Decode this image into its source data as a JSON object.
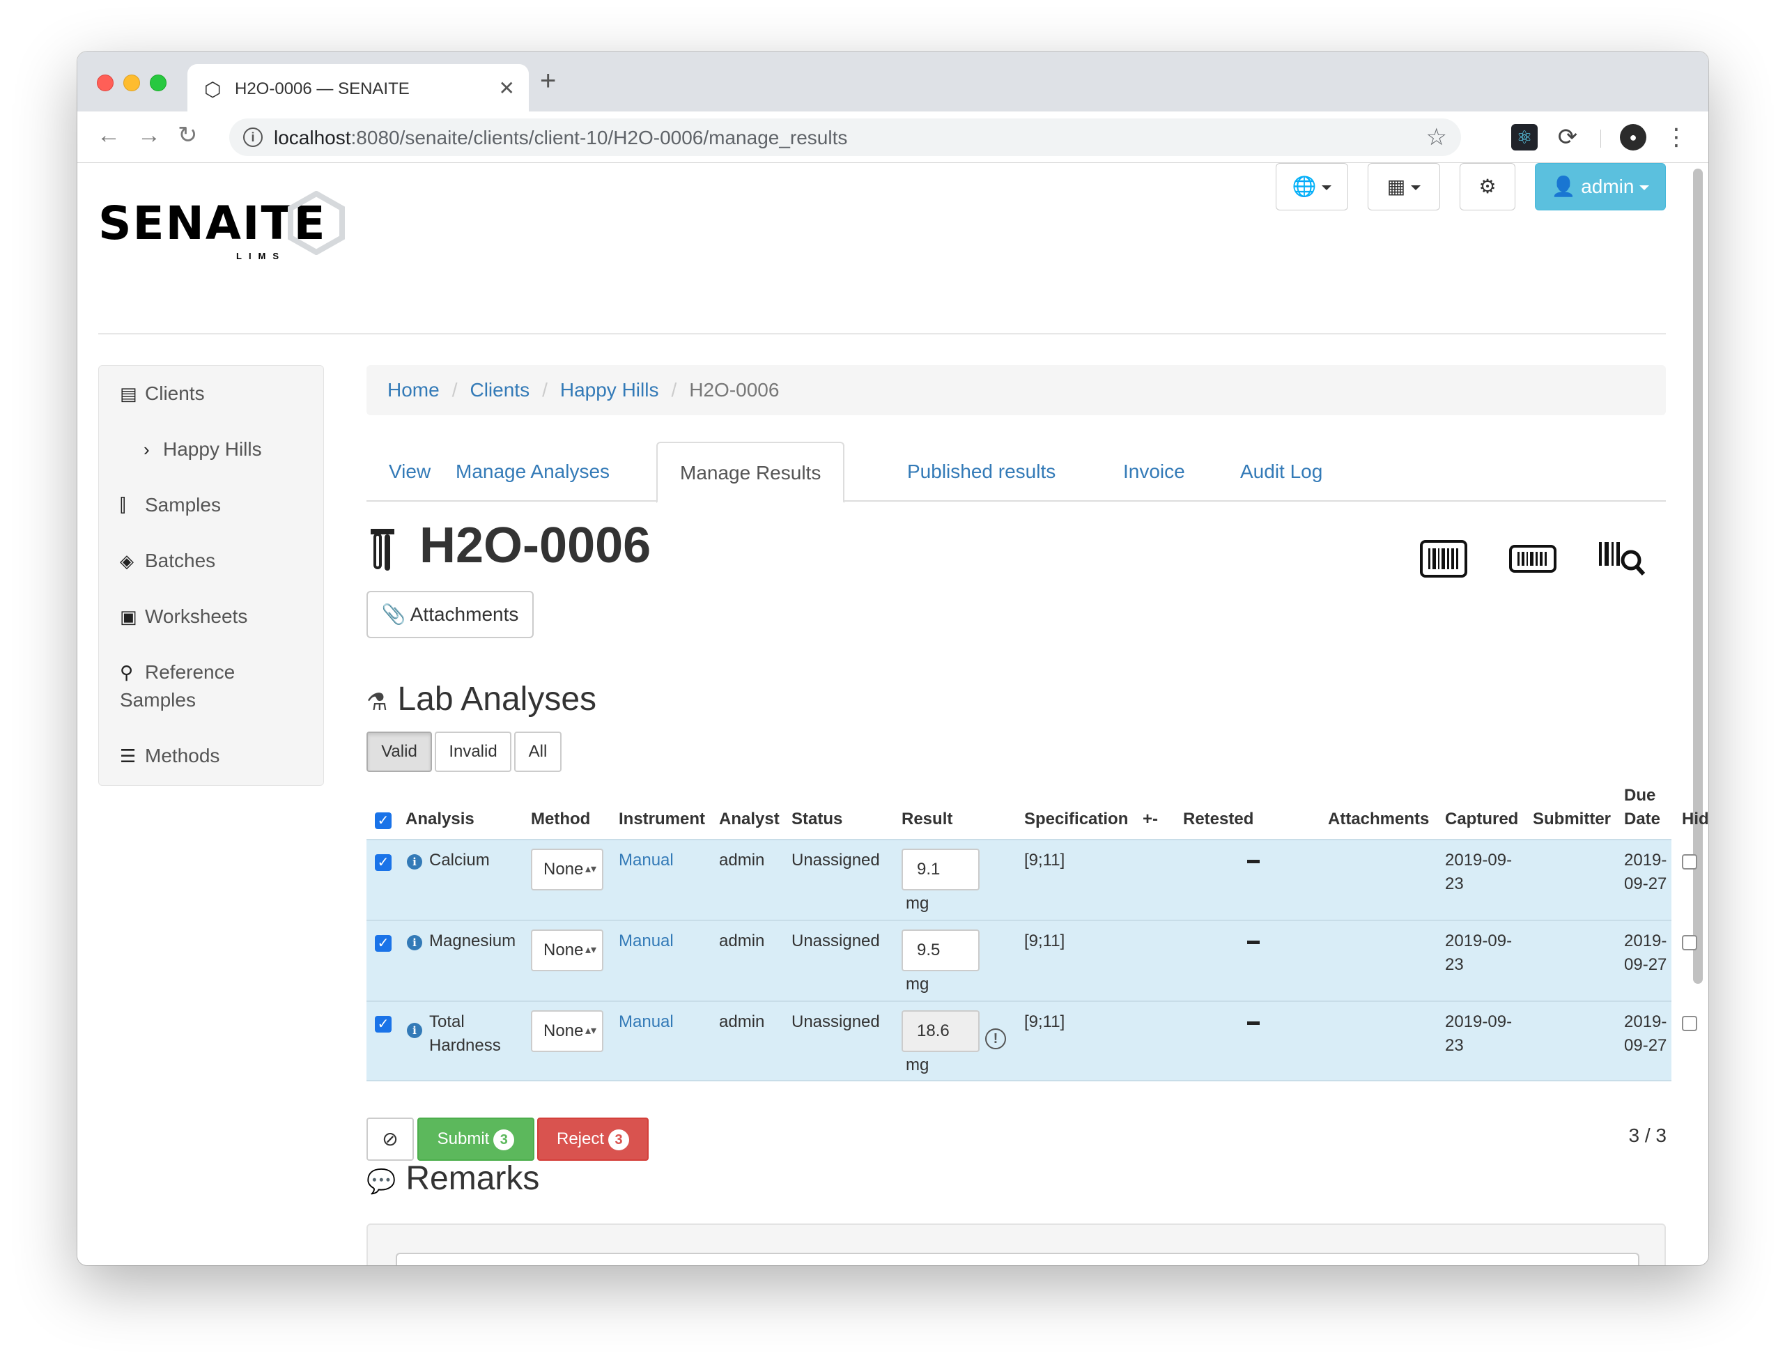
{
  "browser": {
    "tab_title": "H2O-0006 — SENAITE",
    "url_host": "localhost",
    "url_rest": ":8080/senaite/clients/client-10/H2O-0006/manage_results"
  },
  "logo": {
    "word": "SENAITE",
    "sub": "LIMS"
  },
  "header_buttons": {
    "admin_label": "admin"
  },
  "sidebar": {
    "items": [
      {
        "label": "Clients",
        "icon": "client-card-icon"
      },
      {
        "label": "Happy Hills",
        "icon": "chevron-right-icon"
      },
      {
        "label": "Samples",
        "icon": "sample-tube-icon"
      },
      {
        "label": "Batches",
        "icon": "layers-icon"
      },
      {
        "label": "Worksheets",
        "icon": "worksheet-icon"
      },
      {
        "label": "Reference",
        "label2": "Samples",
        "icon": "reference-icon"
      },
      {
        "label": "Methods",
        "icon": "methods-icon"
      }
    ]
  },
  "breadcrumb": [
    "Home",
    "Clients",
    "Happy Hills",
    "H2O-0006"
  ],
  "tabs": [
    "View",
    "Manage Analyses",
    "Manage Results",
    "Published results",
    "Invoice",
    "Audit Log"
  ],
  "active_tab": "Manage Results",
  "title": "H2O-0006",
  "attachments_label": "Attachments",
  "lab_analyses": {
    "title": "Lab Analyses",
    "filters": [
      "Valid",
      "Invalid",
      "All"
    ],
    "active_filter": "Valid",
    "columns": [
      "Analysis",
      "Method",
      "Instrument",
      "Analyst",
      "Status",
      "Result",
      "Specification",
      "+-",
      "Retested",
      "Attachments",
      "Captured",
      "Submitter",
      "Due",
      "Date",
      "Hidden"
    ],
    "rows": [
      {
        "analysis": "Calcium",
        "analysis2": "",
        "method": "None",
        "instrument": "Manual",
        "analyst": "admin",
        "status": "Unassigned",
        "result": "9.1",
        "unit": "mg",
        "spec": "[9;11]",
        "captured1": "2019-09-",
        "captured2": "23",
        "due1": "2019-",
        "due2": "09-27"
      },
      {
        "analysis": "Magnesium",
        "analysis2": "",
        "method": "None",
        "instrument": "Manual",
        "analyst": "admin",
        "status": "Unassigned",
        "result": "9.5",
        "unit": "mg",
        "spec": "[9;11]",
        "captured1": "2019-09-",
        "captured2": "23",
        "due1": "2019-",
        "due2": "09-27"
      },
      {
        "analysis": "Total",
        "analysis2": "Hardness",
        "method": "None",
        "instrument": "Manual",
        "analyst": "admin",
        "status": "Unassigned",
        "result": "18.6",
        "unit": "mg",
        "spec": "[9;11]",
        "captured1": "2019-09-",
        "captured2": "23",
        "due1": "2019-",
        "due2": "09-27"
      }
    ],
    "actions": {
      "submit_label": "Submit",
      "submit_count": "3",
      "reject_label": "Reject",
      "reject_count": "3"
    },
    "pager": "3 / 3"
  },
  "remarks": {
    "title": "Remarks"
  },
  "colors": {
    "link": "#337ab7",
    "row_bg": "#d9edf7",
    "submit": "#5cb85c",
    "reject": "#d9534f",
    "admin": "#5bc0de"
  }
}
